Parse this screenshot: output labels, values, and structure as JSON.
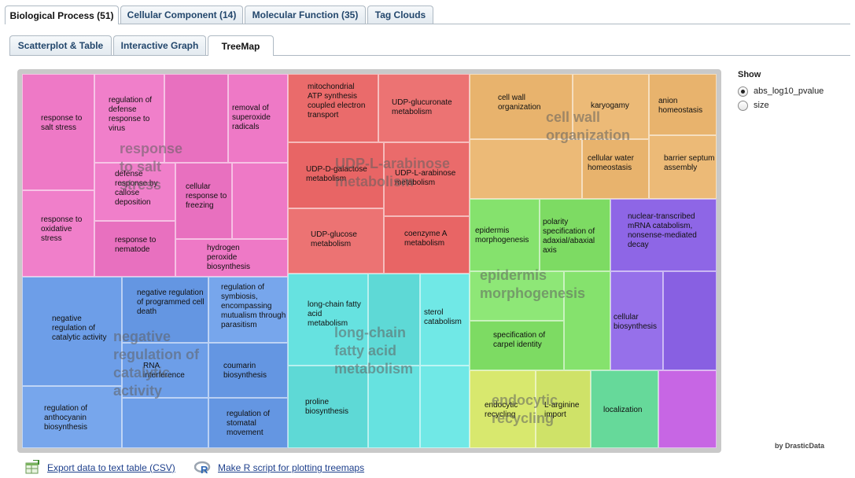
{
  "tabs": [
    "Biological Process (51)",
    "Cellular Component (14)",
    "Molecular Function (35)",
    "Tag Clouds"
  ],
  "subtabs": [
    "Scatterplot & Table",
    "Interactive Graph",
    "TreeMap"
  ],
  "show": {
    "title": "Show",
    "options": [
      "abs_log10_pvalue",
      "size"
    ],
    "selected": "abs_log10_pvalue"
  },
  "credit": "by DrasticData",
  "links": {
    "export": "Export data to text table (CSV)",
    "rscript": "Make R script for plotting treemaps"
  },
  "icons": {
    "export": "csv-export-icon",
    "rscript": "r-logo-icon"
  },
  "treemap": {
    "groups": [
      "response to salt stress",
      "UDP-L-arabinose metabolism",
      "cell wall organization",
      "epidermis morphogenesis",
      "negative regulation of catalytic activity",
      "long-chain fatty acid metabolism",
      "endocytic recycling"
    ],
    "cells": [
      "response to salt stress",
      "regulation of defense response to virus",
      "removal of superoxide radicals",
      "defense response by callose deposition",
      "cellular response to freezing",
      "response to oxidative stress",
      "response to nematode",
      "hydrogen peroxide biosynthesis",
      "mitochondrial ATP synthesis coupled electron transport",
      "UDP-glucuronate metabolism",
      "UDP-D-galactose metabolism",
      "UDP-L-arabinose metabolism",
      "UDP-glucose metabolism",
      "coenzyme A metabolism",
      "cell wall organization",
      "karyogamy",
      "anion homeostasis",
      "cellular water homeostasis",
      "barrier septum assembly",
      "epidermis morphogenesis",
      "polarity specification of adaxial/abaxial axis",
      "nuclear-transcribed mRNA catabolism, nonsense-mediated decay",
      "specification of carpel identity",
      "cellular biosynthesis",
      "negative regulation of catalytic activity",
      "negative regulation of programmed cell death",
      "regulation of symbiosis, encompassing mutualism through parasitism",
      "RNA interference",
      "coumarin biosynthesis",
      "regulation of anthocyanin biosynthesis",
      "regulation of stomatal movement",
      "long-chain fatty acid metabolism",
      "sterol catabolism",
      "proline biosynthesis",
      "endocytic recycling",
      "L-arginine import",
      "localization"
    ]
  }
}
